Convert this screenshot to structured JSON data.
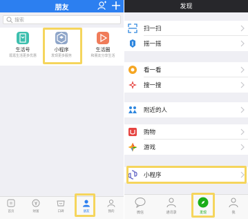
{
  "left": {
    "header": {
      "title": "朋友"
    },
    "search": {
      "placeholder": "搜索"
    },
    "apps": [
      {
        "name": "生活号",
        "desc": "逛逛生活更多优惠",
        "color": "#3dbfae"
      },
      {
        "name": "小程序",
        "desc": "发现更多服务",
        "color": "#8fa6c9"
      },
      {
        "name": "生活圈",
        "desc": "和朋友分享生活",
        "color": "#f07c5a"
      }
    ],
    "tabs": [
      {
        "label": "首页"
      },
      {
        "label": "财富"
      },
      {
        "label": "口碑"
      },
      {
        "label": "朋友"
      },
      {
        "label": "我的"
      }
    ]
  },
  "right": {
    "header": {
      "title": "发现"
    },
    "rows": [
      {
        "label": "扫一扫"
      },
      {
        "label": "摇一摇"
      },
      {
        "label": "看一看"
      },
      {
        "label": "搜一搜"
      },
      {
        "label": "附近的人"
      },
      {
        "label": "购物"
      },
      {
        "label": "游戏"
      },
      {
        "label": "小程序"
      }
    ],
    "tabs": [
      {
        "label": "微信"
      },
      {
        "label": "通讯录"
      },
      {
        "label": "发现"
      },
      {
        "label": "我"
      }
    ]
  },
  "colors": {
    "left_header": "#2c7ff0",
    "right_header": "#27272b",
    "highlight": "#f5d55c",
    "wechat_green": "#1aad19"
  }
}
